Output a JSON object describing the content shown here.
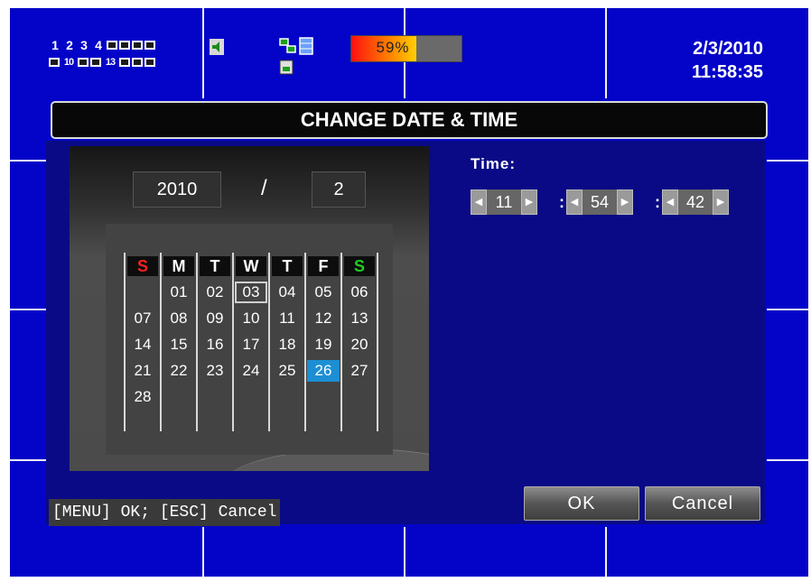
{
  "channels": {
    "row1": [
      "1",
      "2",
      "3",
      "4",
      "",
      "",
      "",
      ""
    ],
    "row2": [
      "",
      "10",
      "",
      "",
      "13",
      "",
      "",
      ""
    ]
  },
  "icons": {
    "audio": "speaker-icon",
    "network": "network-icon",
    "record": "record-icon",
    "disk": "disk-icon"
  },
  "hdd": {
    "percent_label": "59%",
    "usage": 0.59
  },
  "clock": {
    "date": "2/3/2010",
    "time": "11:58:35"
  },
  "dialog": {
    "title": "CHANGE DATE & TIME",
    "year": "2010",
    "separator": "/",
    "month": "2",
    "weekdays": [
      "S",
      "M",
      "T",
      "W",
      "T",
      "F",
      "S"
    ],
    "weeks": [
      [
        "",
        "01",
        "02",
        "03",
        "04",
        "05",
        "06"
      ],
      [
        "07",
        "08",
        "09",
        "10",
        "11",
        "12",
        "13"
      ],
      [
        "14",
        "15",
        "16",
        "17",
        "18",
        "19",
        "20"
      ],
      [
        "21",
        "22",
        "23",
        "24",
        "25",
        "26",
        "27"
      ],
      [
        "28",
        "",
        "",
        "",
        "",
        "",
        ""
      ]
    ],
    "today": "03",
    "selected": "26",
    "time_label": "Time:",
    "hour": "11",
    "minute": "54",
    "second": "42",
    "hint": "[MENU] OK; [ESC] Cancel",
    "ok_label": "OK",
    "cancel_label": "Cancel"
  },
  "colors": {
    "background": "#0404c8",
    "dialog": "#0a0a86",
    "sunday": "#ff2020",
    "saturday": "#22cc22",
    "selected_day": "#1c8fd4"
  }
}
